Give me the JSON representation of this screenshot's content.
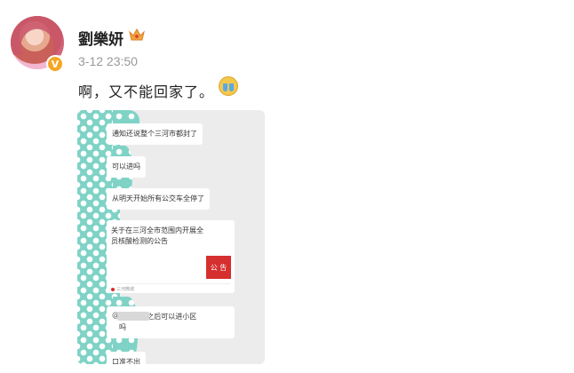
{
  "post": {
    "username": "劉樂妍",
    "verified_badge": "V",
    "time": "3-12 23:50",
    "content": "啊，又不能回家了。",
    "icons": {
      "verified": "verified-v-icon",
      "level": "crown-level-icon",
      "emoji": "crying-emoji-icon"
    }
  },
  "screenshot": {
    "messages": [
      "通知还说整个三河市都封了",
      "可以进吗",
      "从明天开始所有公交车全停了",
      "区  12 点之后可以进小区\n吗",
      "口准不出"
    ],
    "notice": {
      "text": "关于在三河全市范围内开展全员核酸检测的公告",
      "badge": "公 告",
      "source": "三河微城"
    },
    "colors": {
      "accent_teal": "#7fd3c6",
      "notice_red": "#d62f2f"
    }
  }
}
